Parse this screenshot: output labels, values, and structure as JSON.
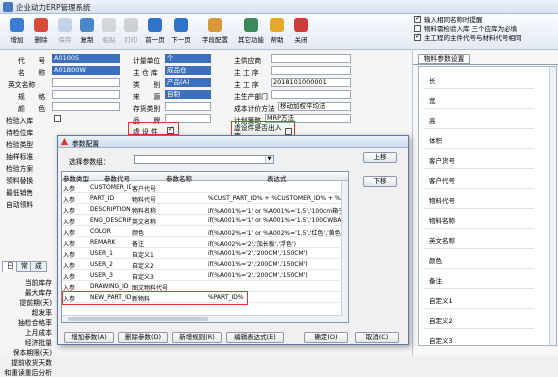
{
  "window": {
    "title": "企业动力ERP管理系统"
  },
  "toolbar": [
    {
      "label": "增加",
      "icon": "add-icon",
      "color": "#3a7bd5",
      "disabled": false
    },
    {
      "label": "删除",
      "icon": "delete-icon",
      "color": "#d84a3a",
      "disabled": false
    },
    {
      "label": "保存",
      "icon": "save-icon",
      "color": "#6b8fc7",
      "disabled": true
    },
    {
      "label": "复制",
      "icon": "copy-icon",
      "color": "#4b87c9",
      "disabled": false
    },
    {
      "label": "粘贴",
      "icon": "paste-icon",
      "color": "#9a9a9a",
      "disabled": true
    },
    {
      "label": "打印",
      "icon": "print-icon",
      "color": "#8a8a8a",
      "disabled": true
    },
    {
      "label": "前一页",
      "icon": "prev-page-icon",
      "color": "#2f74c8",
      "disabled": false
    },
    {
      "label": "下一页",
      "icon": "next-page-icon",
      "color": "#2f74c8",
      "disabled": false
    },
    {
      "label": "字段配置",
      "icon": "field-config-icon",
      "color": "#d8983a",
      "disabled": false
    },
    {
      "label": "其它功能",
      "icon": "other-functions-icon",
      "color": "#3a8a5a",
      "disabled": false
    },
    {
      "label": "帮助",
      "icon": "help-icon",
      "color": "#e7a826",
      "disabled": false
    },
    {
      "label": "关闭",
      "icon": "close-icon",
      "color": "#cf3b3b",
      "disabled": false
    }
  ],
  "options": [
    {
      "label": "输入相同名称时提醒",
      "checked": true
    },
    {
      "label": "物料需检验入库 三个应库为必填",
      "checked": false
    },
    {
      "label": "主工程的主件代号与材料代号相同",
      "checked": true
    }
  ],
  "form": {
    "code_label": "代　　号",
    "code_value": "A01005",
    "name_label": "名　　称",
    "name_value": "A01B00W",
    "en_name_label": "英文名称",
    "spec_label": "规　　格",
    "color_label": "颜　　色",
    "inspect_label": "检验入库",
    "unit_label": "计量单位",
    "unit_value": "个",
    "warehouse_label": "主 仓 库",
    "warehouse_value": "成品仓",
    "category_label": "类　　别",
    "category_value": "产品(A)",
    "source_label": "来　　源",
    "source_value": "自制",
    "stock_type_label": "存货类别",
    "brand_label": "品　　牌",
    "virtual_label": "虚 设 件",
    "supplier_label": "主供应商",
    "process_label": "主 工 序",
    "process_value": "2018101000001",
    "workstation_label": "主 工 序",
    "main_dept_label": "主生产部门",
    "cost_method_label": "成本计价方法",
    "cost_method_value": "移动加权平均法",
    "plan_label": "计划策略",
    "plan_value": "MRP方法",
    "virtual_out_label": "虚设件是否出入库",
    "left_labels": [
      "待检位库",
      "检验类型",
      "抽样标准",
      "检验方案",
      "领料替换",
      "最低销售",
      "自动领料"
    ],
    "tabs": [
      "日",
      "常",
      "成"
    ],
    "tab_labels": [
      "当前库存",
      "最大库存",
      "提前期(天)",
      "超发率",
      "抽检合格率",
      "上月成本",
      "经济批量",
      "保本期限(天)",
      "提前收货天数",
      "和重读重后分析"
    ]
  },
  "side": {
    "tab": "物料参数设置",
    "items": [
      "长",
      "宽",
      "高",
      "体积",
      "客户货号",
      "客户代号",
      "物料代号",
      "物料名称",
      "英文名称",
      "颜色",
      "备注",
      "自定义1",
      "自定义2",
      "自定义3"
    ]
  },
  "dialog": {
    "title": "参数配置",
    "select_label": "选择参数组：",
    "columns": [
      "参数类型",
      "参数代号",
      "参数名称",
      "表达式"
    ],
    "rows": [
      [
        "入参",
        "CUSTOMER_ID",
        "客户代号",
        ""
      ],
      [
        "入参",
        "PART_ID",
        "物料代号",
        "%CUST_PART_ID% + %CUSTOMER_ID% + %A01%+%"
      ],
      [
        "入参",
        "DESCRIPTION",
        "物料名称",
        "if(%A001%='1' or %A001%='1.5','100cm箱子'"
      ],
      [
        "入参",
        "ENG_DESCRIPTION",
        "英文名称",
        "if(%A001%='1' or %A001%='1.5','100CWBAG',"
      ],
      [
        "入参",
        "COLOR",
        "颜色",
        "if(%A002%='1' or %A002%='1.5','红色','黄色"
      ],
      [
        "入参",
        "REMARK",
        "备注",
        "if(%A002%='2','加长板','浮色')"
      ],
      [
        "入参",
        "USER_1",
        "自定义1",
        "if(%A001%='2','200CM','150CM')"
      ],
      [
        "入参",
        "USER_2",
        "自定义2",
        "if(%A001%='2','200CM','150CM')"
      ],
      [
        "入参",
        "USER_3",
        "自定义3",
        "if(%A001%='2','200CM','150CM')"
      ],
      [
        "入参",
        "DRAWING_ID",
        "图文物料代号",
        ""
      ],
      [
        "入参",
        "NEW_PART_ID",
        "新物料",
        "%PART_ID%"
      ]
    ],
    "up_button": "上移",
    "down_button": "下移",
    "buttons": [
      "增加参数(A)",
      "删除参数(D)",
      "新增规则(R)",
      "编辑表达式(E)",
      "确定(O)",
      "取消(C)"
    ]
  },
  "colors": {
    "highlight_box": "#e2352f",
    "selected_field": "#3d6fbf"
  }
}
